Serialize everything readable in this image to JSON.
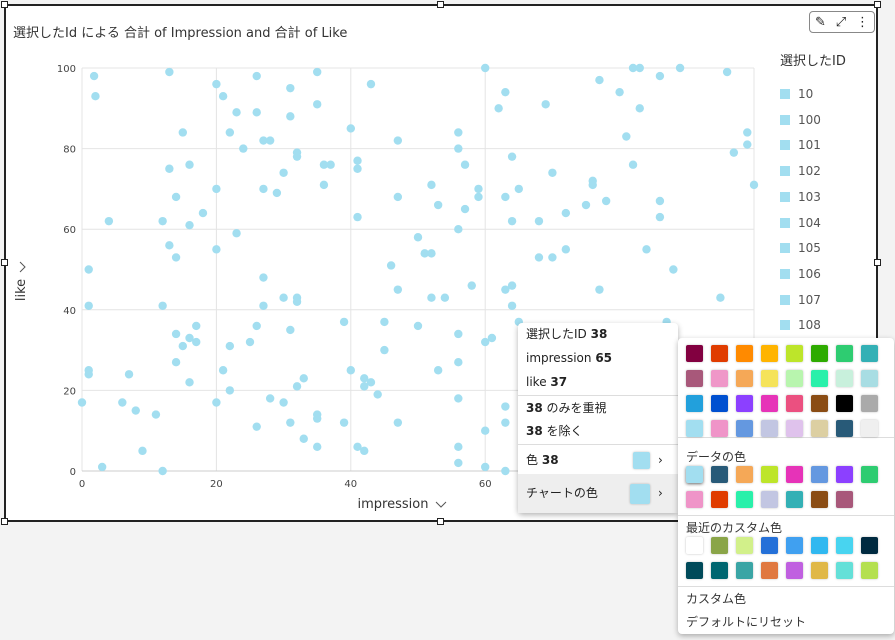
{
  "visual": {
    "title": "選択したId による 合計 of Impression and 合計 of Like",
    "toolbar": {
      "edit_icon": "pencil-icon",
      "expand_icon": "expand-icon",
      "menu_icon": "more-vertical-icon"
    }
  },
  "legend": {
    "title": "選択したID",
    "items": [
      "10",
      "100",
      "101",
      "102",
      "103",
      "104",
      "105",
      "106",
      "107",
      "108"
    ]
  },
  "chart_data": {
    "type": "scatter",
    "xlabel": "impression",
    "ylabel": "like",
    "xlim": [
      0,
      100
    ],
    "ylim": [
      0,
      100
    ],
    "xticks": [
      "0",
      "20",
      "40",
      "60"
    ],
    "yticks": [
      "0",
      "20",
      "40",
      "60",
      "80",
      "100"
    ],
    "grid": true,
    "legend": "right",
    "color": "#a2def0",
    "points": [
      [
        1.8,
        98
      ],
      [
        2,
        93
      ],
      [
        13,
        99
      ],
      [
        20,
        96
      ],
      [
        21,
        93
      ],
      [
        23,
        89
      ],
      [
        26,
        98
      ],
      [
        26,
        89
      ],
      [
        31,
        95
      ],
      [
        31,
        88
      ],
      [
        35,
        99
      ],
      [
        35,
        91
      ],
      [
        43,
        96
      ],
      [
        60,
        100
      ],
      [
        63,
        94
      ],
      [
        62,
        90
      ],
      [
        69,
        91
      ],
      [
        77,
        97
      ],
      [
        80,
        94
      ],
      [
        82,
        100
      ],
      [
        83,
        100
      ],
      [
        86,
        98
      ],
      [
        83,
        90
      ],
      [
        89,
        100
      ],
      [
        96,
        99
      ],
      [
        97,
        79
      ],
      [
        99,
        84
      ],
      [
        99,
        81
      ],
      [
        100,
        71
      ],
      [
        15,
        84
      ],
      [
        13,
        75
      ],
      [
        16,
        76
      ],
      [
        14,
        68
      ],
      [
        16,
        61
      ],
      [
        18,
        64
      ],
      [
        22,
        84
      ],
      [
        24,
        80
      ],
      [
        27,
        82
      ],
      [
        28,
        82
      ],
      [
        27,
        70
      ],
      [
        29,
        69
      ],
      [
        30,
        74
      ],
      [
        32,
        79
      ],
      [
        32,
        78
      ],
      [
        36,
        76
      ],
      [
        37,
        76
      ],
      [
        36,
        71
      ],
      [
        40,
        85
      ],
      [
        41,
        77
      ],
      [
        41,
        75
      ],
      [
        41,
        63
      ],
      [
        47,
        82
      ],
      [
        47,
        68
      ],
      [
        52,
        71
      ],
      [
        53,
        66
      ],
      [
        57,
        65
      ],
      [
        56,
        60
      ],
      [
        56,
        84
      ],
      [
        56,
        80
      ],
      [
        57,
        76
      ],
      [
        59,
        70
      ],
      [
        59,
        68
      ],
      [
        63,
        68
      ],
      [
        65,
        70
      ],
      [
        64,
        78
      ],
      [
        64,
        62
      ],
      [
        68,
        62
      ],
      [
        70,
        74
      ],
      [
        72,
        64
      ],
      [
        75,
        66
      ],
      [
        76,
        72
      ],
      [
        76,
        71
      ],
      [
        78,
        67
      ],
      [
        81,
        83
      ],
      [
        82,
        76
      ],
      [
        86,
        67
      ],
      [
        86,
        63
      ],
      [
        12,
        62
      ],
      [
        4,
        62
      ],
      [
        20,
        70
      ],
      [
        20,
        55
      ],
      [
        13,
        56
      ],
      [
        14,
        53
      ],
      [
        23,
        59
      ],
      [
        1,
        50
      ],
      [
        1,
        41
      ],
      [
        12,
        41
      ],
      [
        27,
        48
      ],
      [
        27,
        41
      ],
      [
        30,
        43
      ],
      [
        32,
        43
      ],
      [
        32,
        42
      ],
      [
        46,
        51
      ],
      [
        47,
        45
      ],
      [
        50,
        58
      ],
      [
        51,
        54
      ],
      [
        52,
        54
      ],
      [
        52,
        43
      ],
      [
        54,
        43
      ],
      [
        58,
        46
      ],
      [
        63,
        45
      ],
      [
        64,
        46
      ],
      [
        64,
        41
      ],
      [
        68,
        53
      ],
      [
        70,
        53
      ],
      [
        72,
        55
      ],
      [
        77,
        45
      ],
      [
        84,
        55
      ],
      [
        88,
        50
      ],
      [
        95,
        43
      ],
      [
        50,
        36
      ],
      [
        45,
        37
      ],
      [
        39,
        37
      ],
      [
        17,
        36
      ],
      [
        17,
        32
      ],
      [
        14,
        34
      ],
      [
        15,
        31
      ],
      [
        16,
        33
      ],
      [
        26,
        36
      ],
      [
        31,
        35
      ],
      [
        25,
        32
      ],
      [
        22,
        31
      ],
      [
        21,
        25
      ],
      [
        45,
        30
      ],
      [
        56,
        34
      ],
      [
        56,
        27
      ],
      [
        60,
        32
      ],
      [
        61,
        33
      ],
      [
        65,
        37
      ],
      [
        14,
        27
      ],
      [
        1,
        25
      ],
      [
        1,
        24
      ],
      [
        7,
        24
      ],
      [
        22,
        20
      ],
      [
        20,
        17
      ],
      [
        16,
        22
      ],
      [
        28,
        18
      ],
      [
        30,
        17
      ],
      [
        32,
        21
      ],
      [
        33,
        23
      ],
      [
        35,
        14
      ],
      [
        35,
        13
      ],
      [
        40,
        25
      ],
      [
        42,
        23
      ],
      [
        42,
        21
      ],
      [
        43,
        22
      ],
      [
        44,
        19
      ],
      [
        39,
        12
      ],
      [
        53,
        25
      ],
      [
        56,
        18
      ],
      [
        63,
        16
      ],
      [
        63,
        12
      ],
      [
        0,
        17
      ],
      [
        6,
        17
      ],
      [
        8,
        15
      ],
      [
        11,
        14
      ],
      [
        9,
        5
      ],
      [
        12,
        0
      ],
      [
        3,
        1
      ],
      [
        26,
        11
      ],
      [
        31,
        12
      ],
      [
        33,
        8
      ],
      [
        35,
        6
      ],
      [
        41,
        6
      ],
      [
        42,
        5
      ],
      [
        47,
        12
      ],
      [
        56,
        6
      ],
      [
        56,
        2
      ],
      [
        60,
        10
      ],
      [
        63,
        0
      ],
      [
        60,
        1
      ],
      [
        87,
        37
      ]
    ]
  },
  "context_menu": {
    "id_label": "選択したID",
    "id_value": "38",
    "impression_label": "impression",
    "impression_value": "65",
    "like_label": "like",
    "like_value": "37",
    "focus_value": "38",
    "focus_label": " のみを重視",
    "exclude_value": "38",
    "exclude_label": " を除く",
    "color_label": "色",
    "color_value": "38",
    "color_swatch": "#a2def0",
    "chart_color_label": "チャートの色",
    "chart_color_swatch": "#a2def0"
  },
  "palette": {
    "base": [
      "#820040",
      "#e03c00",
      "#ff8a00",
      "#ffb400",
      "#bde52a",
      "#2eab00",
      "#2ecc71",
      "#33b0b5",
      "#a8587a",
      "#ef97c8",
      "#f5a857",
      "#f5e35a",
      "#b8f5ae",
      "#29f0aa",
      "#c8f0dc",
      "#a8dde3",
      "#22a0dc",
      "#0050d0",
      "#8c40ff",
      "#e633b8",
      "#eb5080",
      "#8a4c14",
      "#000000",
      "#aaaaaa",
      "#a2def0",
      "#ef94c8",
      "#6498e0",
      "#c2c6e2",
      "#dfc2ec",
      "#dccfa2",
      "#285a78",
      "#efefef"
    ],
    "data_colors_label": "データの色",
    "data": [
      "#a2def0",
      "#285a78",
      "#f5a857",
      "#bde52a",
      "#e633b8",
      "#6498e0",
      "#8c40ff",
      "#2ecc71",
      "#ef94c8",
      "#e03c00",
      "#29f0aa",
      "#c2c6e2",
      "#33b0b5",
      "#8a4c14",
      "#a8587a"
    ],
    "recent_label": "最近のカスタム色",
    "recent": [
      "#ffffff",
      "#8aa548",
      "#d2f08a",
      "#2470d8",
      "#40a0f0",
      "#30b8f0",
      "#48d4f0",
      "#002a40",
      "#004a5a",
      "#006670",
      "#3aa5a5",
      "#e07840",
      "#c060e0",
      "#e0b848",
      "#64e0d8",
      "#b4e050"
    ],
    "custom_label": "カスタム色",
    "reset_label": "デフォルトにリセット"
  }
}
